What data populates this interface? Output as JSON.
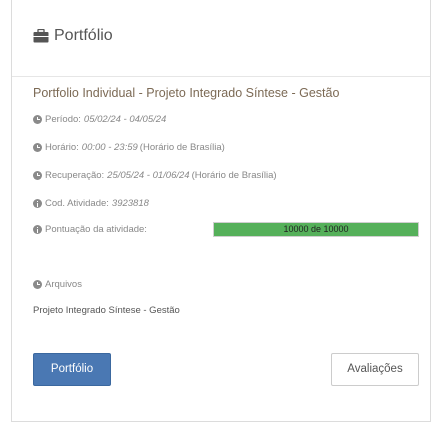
{
  "header": {
    "title": "Portfólio",
    "icon": "briefcase-icon"
  },
  "activity": {
    "title": "Portfolio Individual - Projeto Integrado Síntese - Gestão",
    "periodo_label": "Período:",
    "periodo_value": "05/02/24 - 04/05/24",
    "horario_label": "Horário:",
    "horario_value": "00:00 - 23:59",
    "horario_tz": "(Horário de Brasília)",
    "recuperacao_label": "Recuperação:",
    "recuperacao_value": "25/05/24 - 01/06/24",
    "recuperacao_tz": "(Horário de Brasília)",
    "cod_label": "Cod. Atividade:",
    "cod_value": "3923818",
    "pontuacao_label": "Pontuação da atividade:",
    "pontuacao_text": "10000 de 10000",
    "pontuacao_fraction": 1.0,
    "progress_color": "#55b05a"
  },
  "files": {
    "label": "Arquivos",
    "items": [
      "Projeto Integrado Síntese - Gestão"
    ]
  },
  "buttons": {
    "portfolio": "Portfólio",
    "avaliacoes": "Avaliações"
  },
  "colors": {
    "primary": "#4a78b3",
    "accent_title": "#7c6a55"
  }
}
